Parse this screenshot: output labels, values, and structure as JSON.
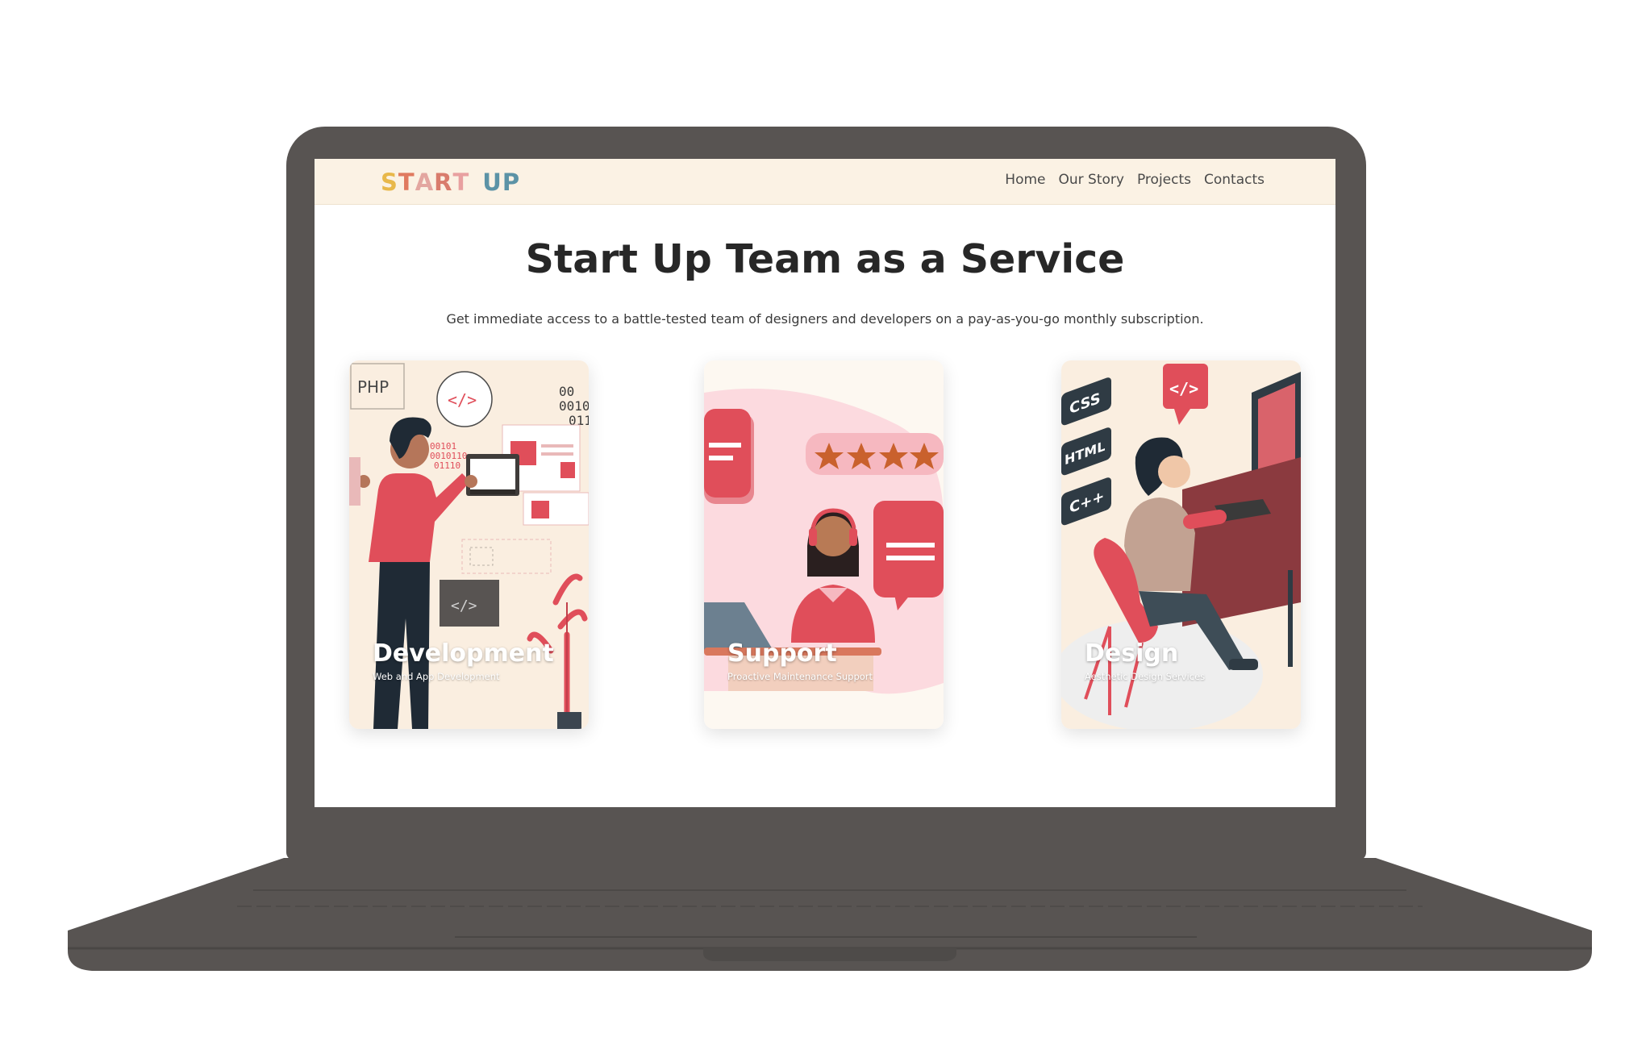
{
  "brand": {
    "logo_letters": [
      "S",
      "T",
      "A",
      "R",
      "T",
      " ",
      "U",
      "P"
    ],
    "logo_colors": [
      "#e8b84a",
      "#e07a5f",
      "#e0a0a0",
      "#d97c6c",
      "#e58f8f",
      "#ffffff",
      "#5c93a6",
      "#5c93a6"
    ]
  },
  "nav": {
    "items": [
      {
        "label": "Home"
      },
      {
        "label": "Our Story"
      },
      {
        "label": "Projects"
      },
      {
        "label": "Contacts"
      }
    ]
  },
  "hero": {
    "title": "Start Up Team as a Service",
    "subtitle": "Get immediate access to a battle-tested team of designers and developers on a pay-as-you-go monthly subscription."
  },
  "cards": [
    {
      "title": "Development",
      "subtitle": "Web and App Development",
      "icon": "developer-illustration"
    },
    {
      "title": "Support",
      "subtitle": "Proactive Maintenance Support",
      "icon": "support-agent-illustration"
    },
    {
      "title": "Design",
      "subtitle": "Aesthetic Design Services",
      "icon": "designer-illustration"
    }
  ],
  "illustration_text": {
    "php": "PHP",
    "code_tag": "</>",
    "binary": [
      "00101",
      "0010110",
      "01110"
    ],
    "binary_right": [
      "00",
      "0010",
      "011"
    ],
    "css": "CSS",
    "html": "HTML",
    "cpp": "C++"
  },
  "colors": {
    "accent": "#e04e5a",
    "nav_bg": "#fbf2e4",
    "title": "#272727",
    "laptop": "#585452"
  }
}
